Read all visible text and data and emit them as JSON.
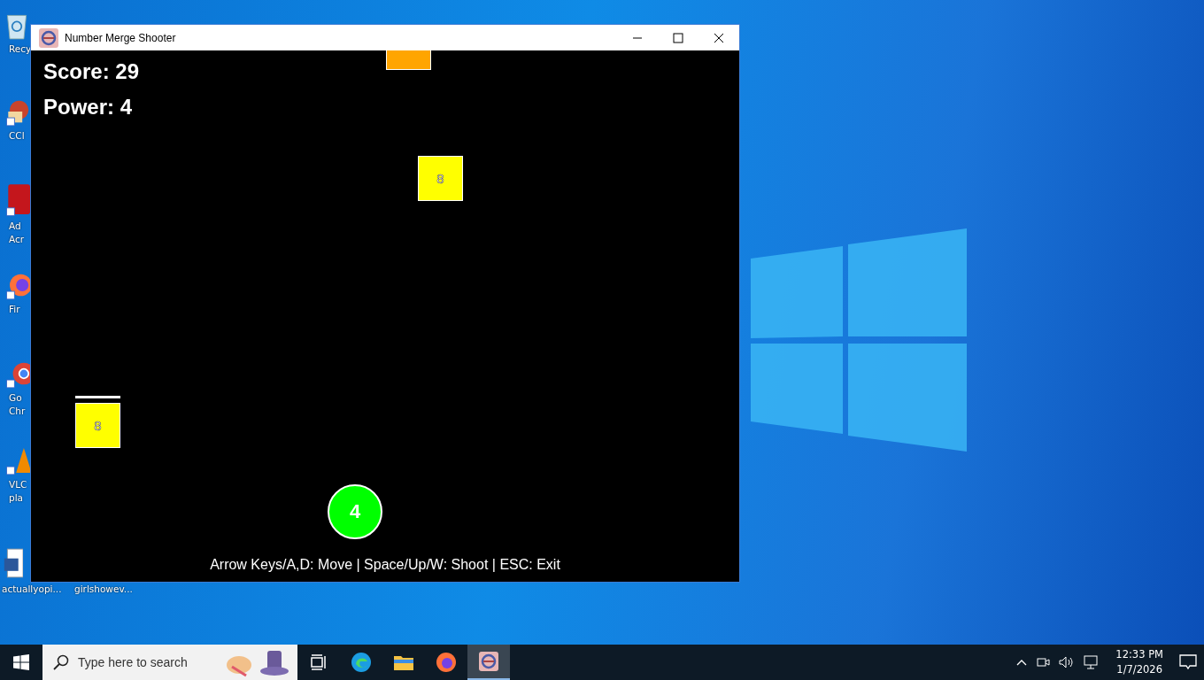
{
  "desktop": {
    "icons": [
      {
        "kind": "recycle",
        "lines": [
          "Recy"
        ]
      },
      {
        "kind": "ccleaner",
        "lines": [
          "CCl"
        ]
      },
      {
        "kind": "acrobat",
        "lines": [
          "Ad",
          "Acr"
        ]
      },
      {
        "kind": "firefox",
        "lines": [
          "Fir"
        ]
      },
      {
        "kind": "chrome",
        "lines": [
          "Go",
          "Chr"
        ]
      },
      {
        "kind": "vlc",
        "lines": [
          "VLC",
          "pla"
        ]
      },
      {
        "kind": "word",
        "lines": [
          "actuallyopi..."
        ]
      },
      {
        "kind": "blank",
        "lines": [
          "girlshowev..."
        ]
      }
    ]
  },
  "window": {
    "title": "Number Merge Shooter"
  },
  "game": {
    "score": "Score: 29",
    "power": "Power: 4",
    "blocks": [
      {
        "color": "#ffa500"
      },
      {
        "color": "#ffff00",
        "label": "8"
      },
      {
        "color": "#ffff00",
        "label": "8"
      }
    ],
    "player": {
      "label": "4",
      "color": "#00ff00"
    },
    "help": "Arrow Keys/A,D: Move | Space/Up/W: Shoot | ESC: Exit"
  },
  "taskbar": {
    "search": {
      "placeholder": "Type here to search"
    },
    "apps": [
      {
        "kind": "taskview",
        "selected": false
      },
      {
        "kind": "edge",
        "selected": false
      },
      {
        "kind": "explorer",
        "selected": false
      },
      {
        "kind": "firefox",
        "selected": false
      },
      {
        "kind": "game",
        "selected": true
      }
    ],
    "time": "12:33 PM",
    "date": "1/7/2026"
  }
}
